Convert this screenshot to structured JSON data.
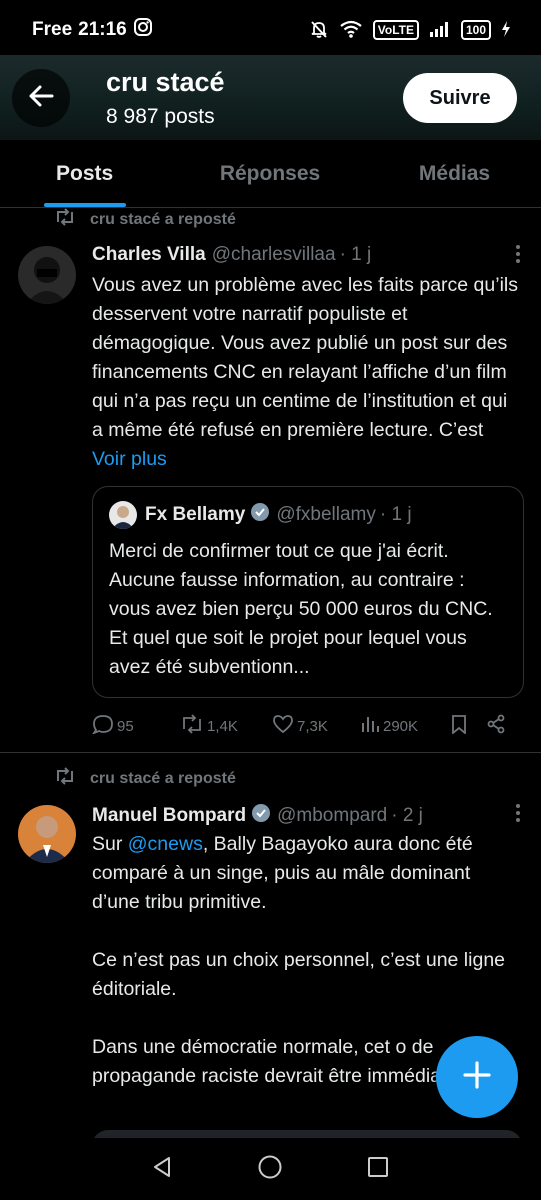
{
  "status_bar": {
    "carrier": "Free",
    "time": "21:16",
    "volte": "VoLTE",
    "battery": "100"
  },
  "header": {
    "title": "cru stacé",
    "post_count": "8 987 posts",
    "follow_label": "Suivre"
  },
  "tabs": [
    {
      "label": "Posts",
      "active": true
    },
    {
      "label": "Réponses",
      "active": false
    },
    {
      "label": "Médias",
      "active": false
    }
  ],
  "tweets": [
    {
      "repost_label": "cru stacé a reposté",
      "name": "Charles Villa",
      "handle": "@charlesvillaa",
      "time": "· 1 j",
      "verified": false,
      "body": "Vous avez un problème avec les faits parce qu’ils desservent votre narratif populiste et démagogique. Vous avez publié un post sur des financements CNC en relayant l’affiche d’un film qui n’a pas reçu un centime de l’institution et qui a même été refusé en première lecture. C’est ",
      "see_more": "Voir plus",
      "quote": {
        "name": "Fx Bellamy",
        "handle": "@fxbellamy",
        "time": "· 1 j",
        "body": "Merci de confirmer tout ce que j'ai écrit. Aucune fausse information, au contraire : vous avez bien perçu 50 000 euros du CNC. Et quel que soit le projet pour lequel vous avez été subventionn..."
      },
      "actions": {
        "replies": "95",
        "reposts": "1,4K",
        "likes": "7,3K",
        "views": "290K"
      }
    },
    {
      "repost_label": "cru stacé a reposté",
      "name": "Manuel Bompard",
      "handle": "@mbompard",
      "time": "· 2 j",
      "verified": true,
      "body_prefix": "Sur ",
      "mention": "@cnews",
      "body_line1": ", Bally Bagayoko aura donc été comparé à un singe, puis au mâle dominant d’une tribu primitive.",
      "body_para2": "Ce n’est pas un choix personnel, c’est une ligne éditoriale.",
      "body_para3": "Dans une démocratie normale, cet o de propagande raciste devrait être immédiatement."
    }
  ],
  "colors": {
    "accent": "#1d9bf0",
    "muted": "#71767b",
    "text": "#e7e9ea",
    "background": "#000000"
  }
}
